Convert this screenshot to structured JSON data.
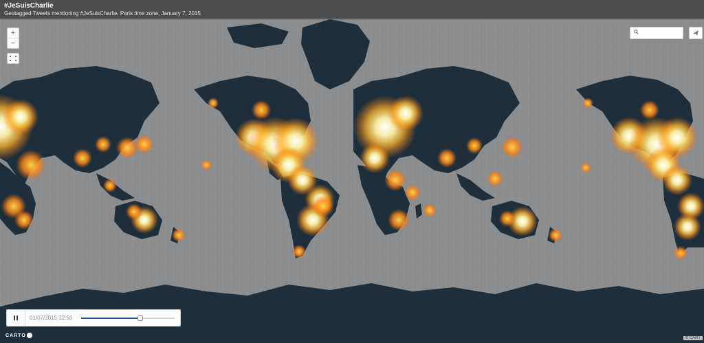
{
  "header": {
    "title": "#JeSuisCharlie",
    "subtitle": "Geotagged Tweets mentioning #JeSuisCharlie, Paris time zone, January 7, 2015"
  },
  "controls": {
    "zoom_in_label": "+",
    "zoom_out_label": "−",
    "search_placeholder": ""
  },
  "timeslider": {
    "timestamp": "01/07/2015 22:50",
    "progress": 0.63
  },
  "footer": {
    "logo_text": "CARTO",
    "attribution": "© CART"
  },
  "colors": {
    "ocean": "#8a8c8e",
    "land": "#1e2f3b",
    "heat_core": "#ffffff",
    "heat_mid": "#ffd24a",
    "heat_outer": "#ff7e12",
    "header_bg": "#4a4c4e",
    "slider_fill": "#28509a"
  }
}
